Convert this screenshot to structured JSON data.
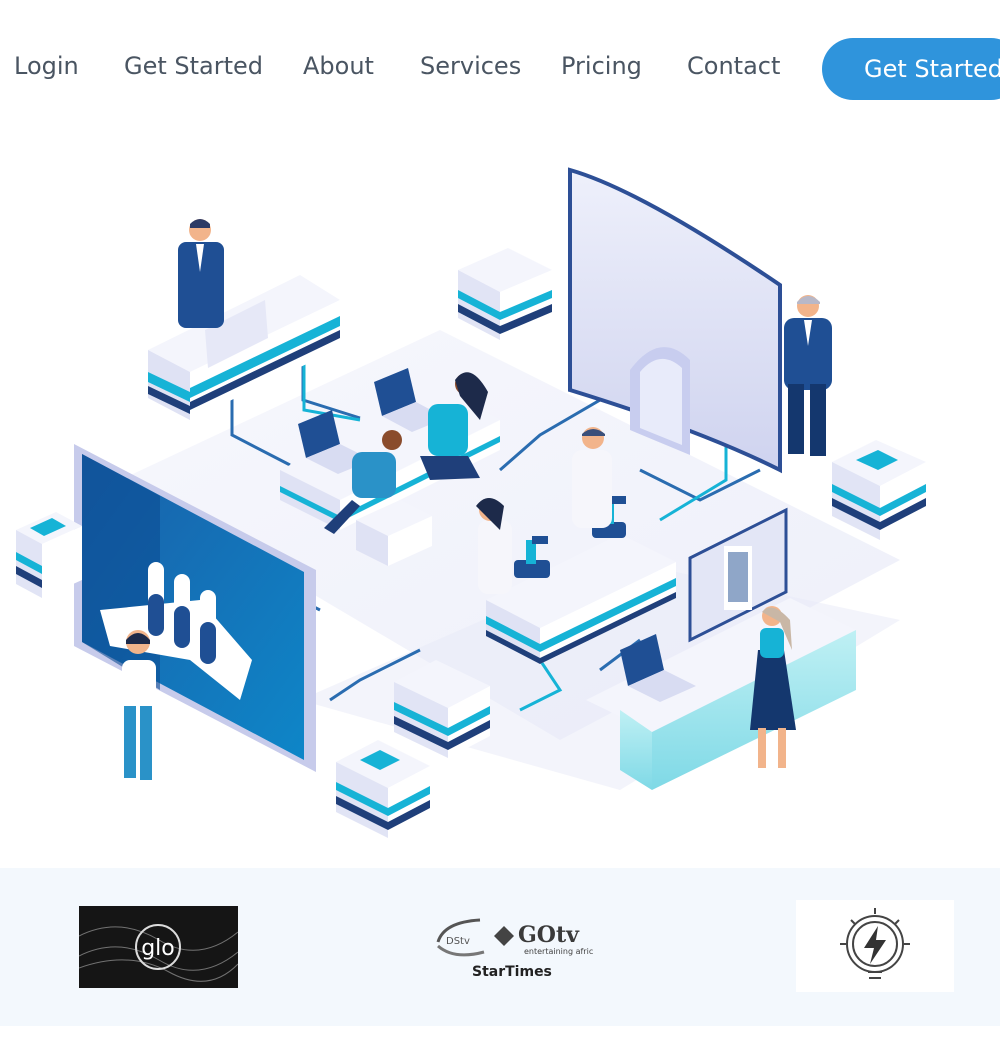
{
  "nav": {
    "links": [
      "Login",
      "Get Started",
      "About",
      "Services",
      "Pricing",
      "Contact"
    ],
    "cta_label": "Get Started"
  },
  "hero": {
    "illustration": "isometric-lab-workspace-illustration"
  },
  "partners": {
    "logos": [
      {
        "name": "glo",
        "text": "glo"
      },
      {
        "name": "dstv-gotv-startimes",
        "text_top": "GOtv",
        "text_sub": "entertaining afric",
        "text_dstv": "DStv",
        "text_bottom": "StarTimes"
      },
      {
        "name": "lightbulb-bolt"
      }
    ]
  },
  "colors": {
    "accent": "#2f94dc",
    "nav_text": "#4a5562",
    "band_bg": "#f3f8fd",
    "navy": "#1f3f7a",
    "cyan": "#16b3d6"
  }
}
